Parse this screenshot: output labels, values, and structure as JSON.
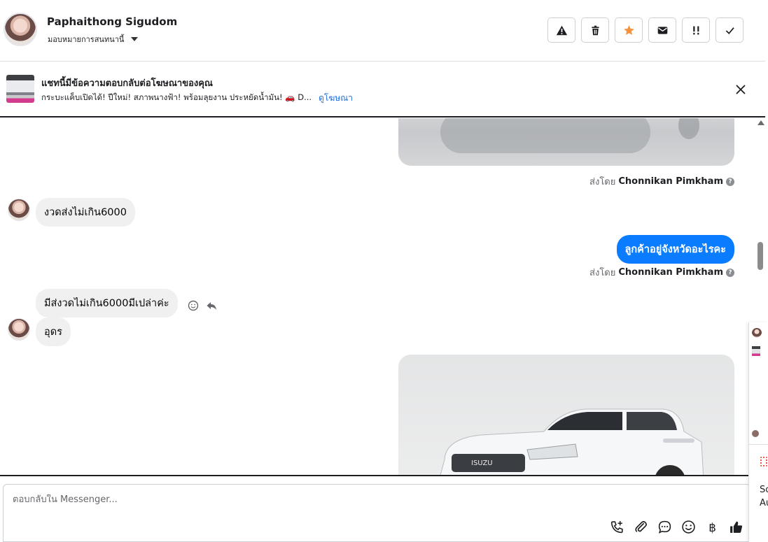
{
  "header": {
    "contact_name": "Paphaithong Sigudom",
    "assign_label": "มอบหมายการสนทนานี้",
    "toolbar_icons": [
      "warning-icon",
      "trash-icon",
      "star-icon",
      "mail-icon",
      "priority-icon",
      "checkmark-icon"
    ],
    "star_color": "#f7923a"
  },
  "ad_banner": {
    "title": "แชทนี้มีข้อความตอบกลับต่อโฆษณาของคุณ",
    "subtitle": "กระบะแค็บเปิดได้! ปีใหม่! สภาพนางฟ้า! พร้อมลุยงาน ประหยัดน้ำมัน! 🚗 D...",
    "link_text": "ดูโฆษณา"
  },
  "conversation": {
    "sent_by_prefix": "ส่งโดย",
    "agent_name": "Chonnikan Pimkham",
    "help_glyph": "?",
    "messages": [
      {
        "direction": "in",
        "text": "งวดส่งไม่เกิน6000"
      },
      {
        "direction": "out",
        "text": "ลูกค้าอยู่จังหวัดอะไรคะ"
      },
      {
        "direction": "in",
        "text": "มีส่งวดไม่เกิน6000มีเปล่าค่ะ"
      },
      {
        "direction": "in",
        "text": "อุดร"
      }
    ],
    "car_brand": "ISUZU",
    "accent_color": "#0a7cff"
  },
  "composer": {
    "placeholder": "ตอบกลับใน Messenger...",
    "tools": [
      "phone-add-icon",
      "attachment-icon",
      "chat-bubble-icon",
      "emoji-icon",
      "baht-icon",
      "thumbs-up-icon"
    ],
    "baht_glyph": "฿"
  },
  "side_panel": {
    "text_line1": "So",
    "text_line2": "Au"
  }
}
